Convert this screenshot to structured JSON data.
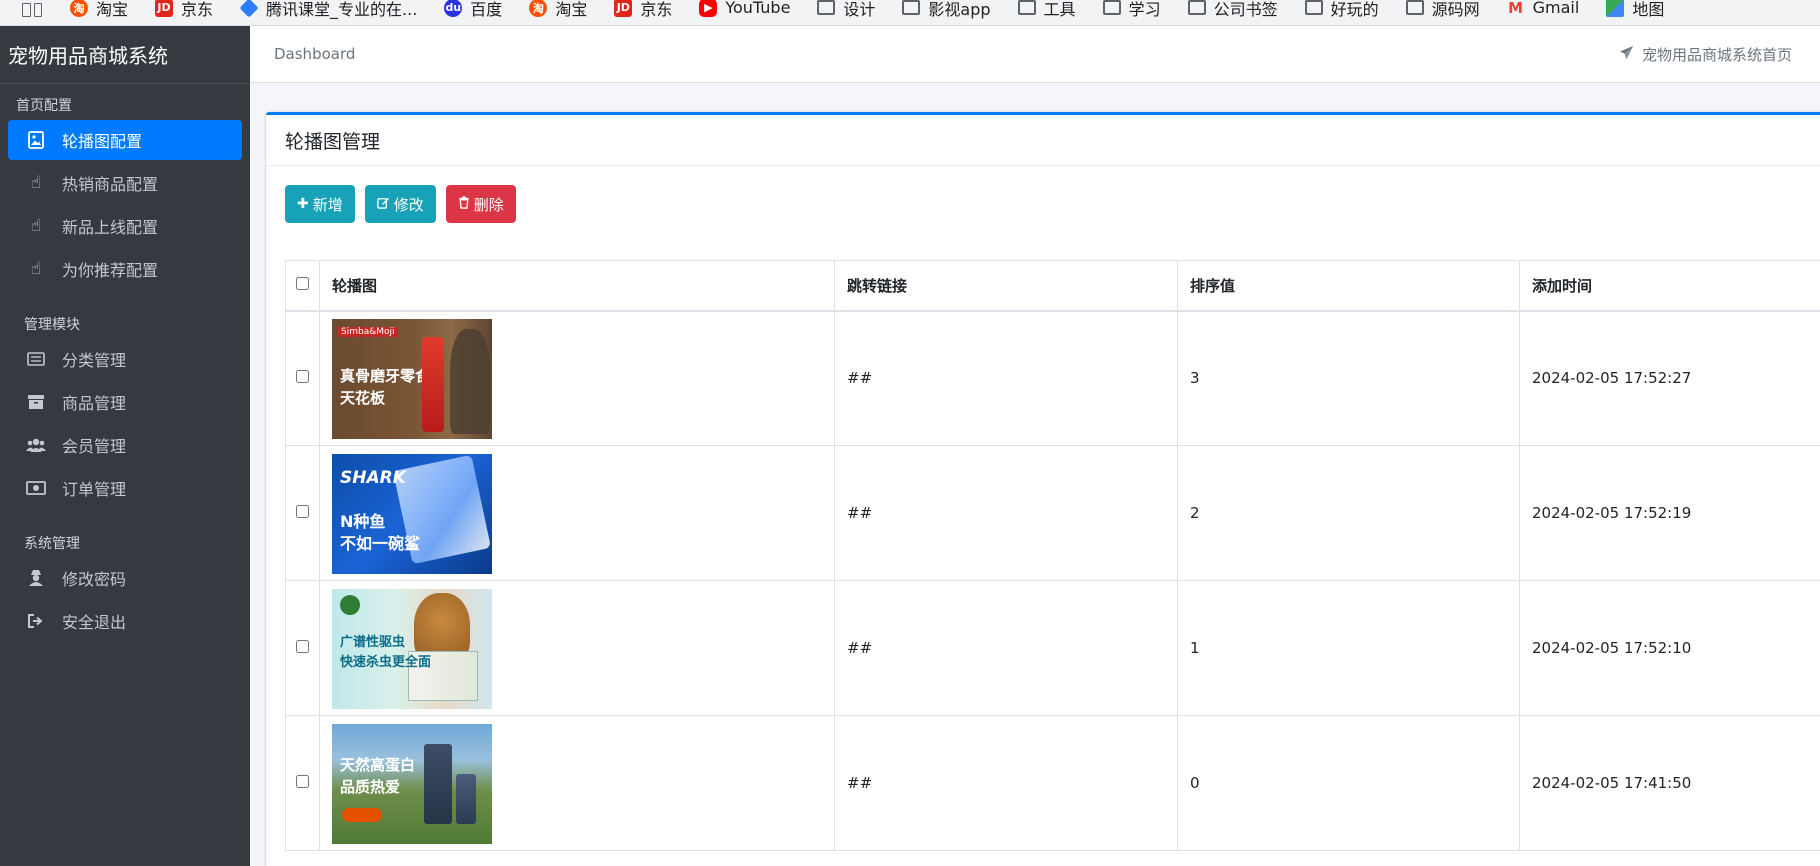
{
  "bookmarks": [
    {
      "label": "淘宝",
      "icon": "taobao-icon"
    },
    {
      "label": "京东",
      "icon": "jd-icon"
    },
    {
      "label": "腾讯课堂_专业的在...",
      "icon": "tencent-icon"
    },
    {
      "label": "百度",
      "icon": "baidu-icon"
    },
    {
      "label": "淘宝",
      "icon": "taobao-icon"
    },
    {
      "label": "京东",
      "icon": "jd-icon"
    },
    {
      "label": "YouTube",
      "icon": "youtube-icon"
    },
    {
      "label": "设计",
      "icon": "folder-icon"
    },
    {
      "label": "影视app",
      "icon": "folder-icon"
    },
    {
      "label": "工具",
      "icon": "folder-icon"
    },
    {
      "label": "学习",
      "icon": "folder-icon"
    },
    {
      "label": "公司书签",
      "icon": "folder-icon"
    },
    {
      "label": "好玩的",
      "icon": "folder-icon"
    },
    {
      "label": "源码网",
      "icon": "folder-icon"
    },
    {
      "label": "Gmail",
      "icon": "gmail-icon"
    },
    {
      "label": "地图",
      "icon": "maps-icon"
    }
  ],
  "sidebar": {
    "brand": "宠物用品商城系统",
    "sections": [
      {
        "header": "首页配置",
        "items": [
          {
            "label": "轮播图配置",
            "icon": "image-icon",
            "active": true
          },
          {
            "label": "热销商品配置",
            "icon": "pointer-hand-icon",
            "active": false
          },
          {
            "label": "新品上线配置",
            "icon": "pointer-hand-icon",
            "active": false
          },
          {
            "label": "为你推荐配置",
            "icon": "pointer-hand-icon",
            "active": false
          }
        ]
      },
      {
        "header": "管理模块",
        "items": [
          {
            "label": "分类管理",
            "icon": "list-icon",
            "active": false
          },
          {
            "label": "商品管理",
            "icon": "archive-icon",
            "active": false
          },
          {
            "label": "会员管理",
            "icon": "users-icon",
            "active": false
          },
          {
            "label": "订单管理",
            "icon": "money-icon",
            "active": false
          }
        ]
      },
      {
        "header": "系统管理",
        "items": [
          {
            "label": "修改密码",
            "icon": "user-secret-icon",
            "active": false
          },
          {
            "label": "安全退出",
            "icon": "sign-out-icon",
            "active": false
          }
        ]
      }
    ]
  },
  "topbar": {
    "breadcrumb": "Dashboard",
    "home_link": "宠物用品商城系统首页",
    "home_icon": "paper-plane-icon"
  },
  "card": {
    "title": "轮播图管理",
    "buttons": {
      "add": "新增",
      "edit": "修改",
      "delete": "删除"
    }
  },
  "table": {
    "columns": [
      "轮播图",
      "跳转链接",
      "排序值",
      "添加时间"
    ],
    "rows": [
      {
        "image_text": [
          "真骨磨牙零食",
          "天花板"
        ],
        "image_brand": "Simba&Moji",
        "link": "##",
        "sort": "3",
        "time": "2024-02-05 17:52:27"
      },
      {
        "image_text": [
          "N种鱼",
          "不如一碗鲨"
        ],
        "image_brand": "SHARK",
        "link": "##",
        "sort": "2",
        "time": "2024-02-05 17:52:19"
      },
      {
        "image_text": [
          "广谱性驱虫",
          "快速杀虫更全面"
        ],
        "image_brand": "",
        "link": "##",
        "sort": "1",
        "time": "2024-02-05 17:52:10"
      },
      {
        "image_text": [
          "天然高蛋白",
          "品质热爱"
        ],
        "image_brand": "",
        "link": "##",
        "sort": "0",
        "time": "2024-02-05 17:41:50"
      }
    ]
  },
  "colors": {
    "sidebar_bg": "#343a40",
    "primary": "#007bff",
    "info": "#17a2b8",
    "danger": "#dc3545"
  }
}
